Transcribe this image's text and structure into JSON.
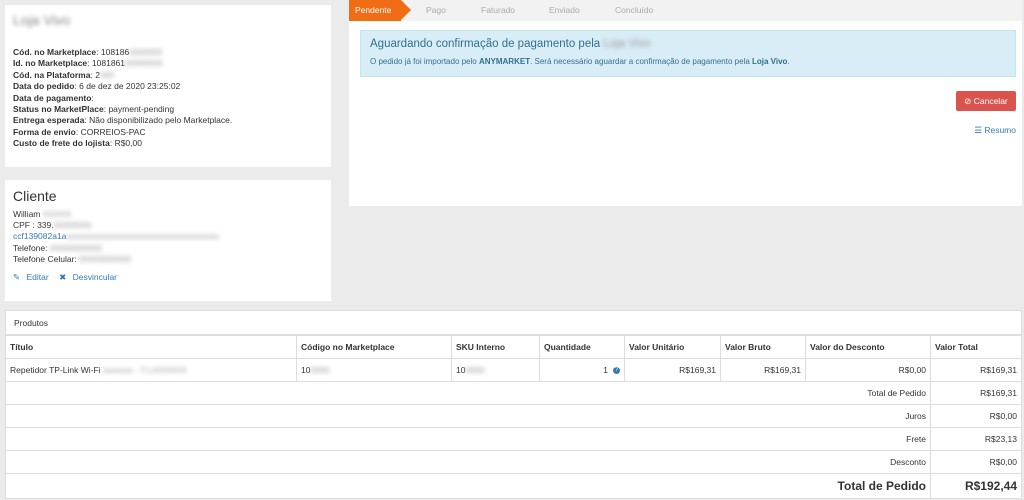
{
  "order": {
    "store_name": "Loja Vivo",
    "rows": [
      {
        "label": "Cód. no Marketplace",
        "value": "108186",
        "blur": "0000000"
      },
      {
        "label": "Id. no Marketplace",
        "value": "1081861",
        "blur": "00000000"
      },
      {
        "label": "Cód. na Plataforma",
        "value": "2",
        "blur": "000"
      },
      {
        "label": "Data do pedido",
        "value": "6 de dez de 2020 23:25:02",
        "blur": ""
      },
      {
        "label": "Data de pagamento",
        "value": "",
        "blur": ""
      },
      {
        "label": "Status no MarketPlace",
        "value": "payment-pending",
        "blur": ""
      },
      {
        "label": "Entrega esperada",
        "value": "Não disponibilizado pelo Marketplace.",
        "blur": ""
      },
      {
        "label": "Forma de envio",
        "value": "CORREIOS-PAC",
        "blur": ""
      },
      {
        "label": "Custo de frete do lojista",
        "value": "R$0,00",
        "blur": ""
      }
    ]
  },
  "client": {
    "title": "Cliente",
    "name": "William",
    "name_blur": "XXXXX",
    "cpf": "CPF : 339.",
    "cpf_blur": "00000000",
    "email": "ccf139082a1a",
    "email_blur": "xxxxxxxxxxxxxxxxxxxxxxxxxxxxxxxxxxxx",
    "phone": "Telefone:",
    "phone_blur": "00000000000",
    "mobile": "Telefone Celular:",
    "mobile_blur": "00000000000",
    "edit": "Editar",
    "unlink": "Desvincular"
  },
  "status": {
    "steps": [
      "Pendente",
      "Pago",
      "Faturado",
      "Enviado",
      "Concluído"
    ],
    "alert_title": "Aguardando confirmação de pagamento pela",
    "alert_store": "Loja Vivo",
    "alert_text_1": "O pedido já foi importado pelo ",
    "alert_bold_1": "ANYMARKET",
    "alert_text_2": ". Será necessário aguardar a confirmação de pagamento pela ",
    "alert_bold_2": "Loja Vivo",
    "alert_text_3": ".",
    "cancel": "Cancelar",
    "resumo": "Resumo"
  },
  "products": {
    "title": "Produtos",
    "headers": [
      "Título",
      "Código no Marketplace",
      "SKU Interno",
      "Quantidade",
      "Valor Unitário",
      "Valor Bruto",
      "Valor do Desconto",
      "Valor Total"
    ],
    "row": {
      "title": "Repetidor TP-Link Wi-Fi",
      "title_blur": "xxxxxxx - T-LXXXXXX",
      "code": "10",
      "code_blur": "0000",
      "sku": "10",
      "sku_blur": "0000",
      "qty": "1",
      "unit": "R$169,31",
      "gross": "R$169,31",
      "discount": "R$0,00",
      "total": "R$169,31"
    },
    "summary": [
      {
        "label": "Total de Pedido",
        "value": "R$169,31"
      },
      {
        "label": "Juros",
        "value": "R$0,00"
      },
      {
        "label": "Frete",
        "value": "R$23,13"
      },
      {
        "label": "Desconto",
        "value": "R$0,00"
      }
    ],
    "grand_label": "Total de Pedido",
    "grand_value": "R$192,44"
  },
  "colors": {
    "accent": "#f06d15",
    "danger": "#d9534f",
    "link": "#337ab7",
    "info_bg": "#d9edf7"
  }
}
